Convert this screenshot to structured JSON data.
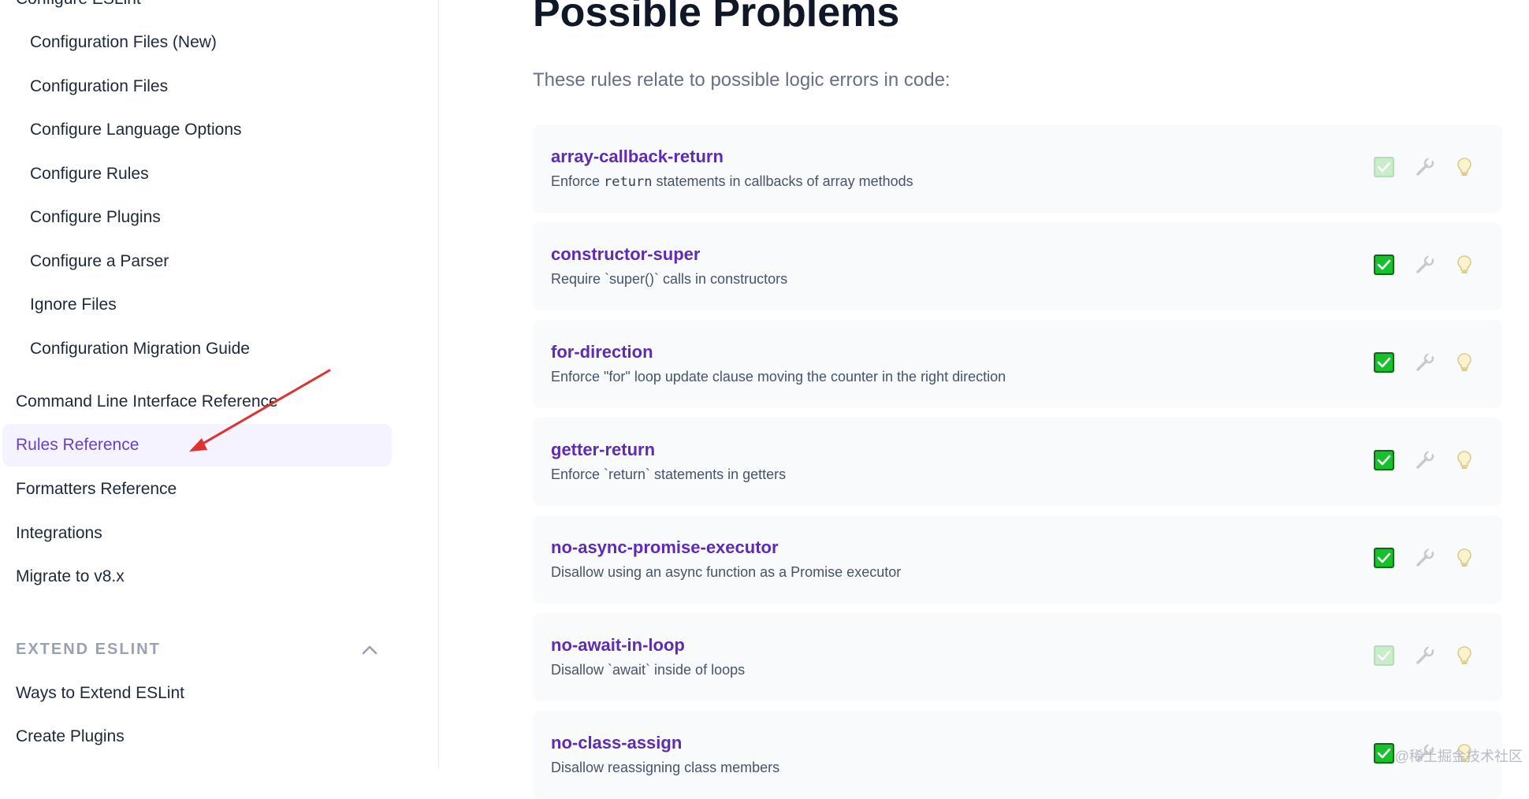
{
  "sidebar": {
    "items": [
      {
        "label": "Configure ESLint",
        "level": "top"
      },
      {
        "label": "Configuration Files (New)",
        "level": "sub"
      },
      {
        "label": "Configuration Files",
        "level": "sub"
      },
      {
        "label": "Configure Language Options",
        "level": "sub"
      },
      {
        "label": "Configure Rules",
        "level": "sub"
      },
      {
        "label": "Configure Plugins",
        "level": "sub"
      },
      {
        "label": "Configure a Parser",
        "level": "sub"
      },
      {
        "label": "Ignore Files",
        "level": "sub"
      },
      {
        "label": "Configuration Migration Guide",
        "level": "sub"
      },
      {
        "label": "Command Line Interface Reference",
        "level": "top"
      },
      {
        "label": "Rules Reference",
        "level": "top",
        "active": true
      },
      {
        "label": "Formatters Reference",
        "level": "top"
      },
      {
        "label": "Integrations",
        "level": "top"
      },
      {
        "label": "Migrate to v8.x",
        "level": "top"
      }
    ],
    "section": {
      "title": "EXTEND ESLINT",
      "icon": "chevron-up-icon",
      "items": [
        {
          "label": "Ways to Extend ESLint"
        },
        {
          "label": "Create Plugins"
        }
      ]
    }
  },
  "main": {
    "title": "Possible Problems",
    "lead": "These rules relate to possible logic errors in code:",
    "rules": [
      {
        "name": "array-callback-return",
        "desc_pre": "Enforce ",
        "desc_code": "return",
        "desc_post": " statements in callbacks of array methods",
        "recommended": false
      },
      {
        "name": "constructor-super",
        "desc_pre": "Require `super()` calls in constructors",
        "desc_code": "",
        "desc_post": "",
        "recommended": true
      },
      {
        "name": "for-direction",
        "desc_pre": "Enforce \"for\" loop update clause moving the counter in the right direction",
        "desc_code": "",
        "desc_post": "",
        "recommended": true
      },
      {
        "name": "getter-return",
        "desc_pre": "Enforce `return` statements in getters",
        "desc_code": "",
        "desc_post": "",
        "recommended": true
      },
      {
        "name": "no-async-promise-executor",
        "desc_pre": "Disallow using an async function as a Promise executor",
        "desc_code": "",
        "desc_post": "",
        "recommended": true
      },
      {
        "name": "no-await-in-loop",
        "desc_pre": "Disallow `await` inside of loops",
        "desc_code": "",
        "desc_post": "",
        "recommended": false
      },
      {
        "name": "no-class-assign",
        "desc_pre": "Disallow reassigning class members",
        "desc_code": "",
        "desc_post": "",
        "recommended": true
      }
    ]
  },
  "colors": {
    "accent": "#5e2bb1",
    "active_bg": "#f4f3ff",
    "check_on": "#16c12b",
    "check_off": "#c9ecc9",
    "annotation": "#e03131"
  },
  "watermark": "@稀土掘金技术社区"
}
